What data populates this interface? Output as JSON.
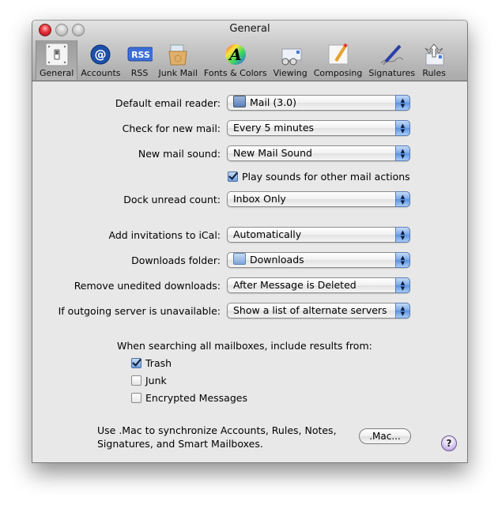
{
  "window": {
    "title": "General",
    "traffic_lights": [
      "close",
      "minimize",
      "zoom"
    ]
  },
  "toolbar": {
    "selected": "General",
    "items": [
      {
        "label": "General",
        "icon": "light-switch-icon"
      },
      {
        "label": "Accounts",
        "icon": "at-sign-icon"
      },
      {
        "label": "RSS",
        "icon": "rss-icon"
      },
      {
        "label": "Junk Mail",
        "icon": "junk-mail-icon"
      },
      {
        "label": "Fonts & Colors",
        "icon": "fonts-colors-icon"
      },
      {
        "label": "Viewing",
        "icon": "viewing-glasses-icon"
      },
      {
        "label": "Composing",
        "icon": "composing-pencil-icon"
      },
      {
        "label": "Signatures",
        "icon": "signature-pen-icon"
      },
      {
        "label": "Rules",
        "icon": "rules-arrows-icon"
      }
    ]
  },
  "settings": {
    "default_email_reader": {
      "label": "Default email reader:",
      "value": "Mail (3.0)",
      "icon": "mail-app-icon"
    },
    "check_new_mail": {
      "label": "Check for new mail:",
      "value": "Every 5 minutes"
    },
    "new_mail_sound": {
      "label": "New mail sound:",
      "value": "New Mail Sound"
    },
    "play_sounds": {
      "label": "Play sounds for other mail actions",
      "checked": true
    },
    "dock_unread_count": {
      "label": "Dock unread count:",
      "value": "Inbox Only"
    },
    "add_invitations": {
      "label": "Add invitations to iCal:",
      "value": "Automatically"
    },
    "downloads_folder": {
      "label": "Downloads folder:",
      "value": "Downloads",
      "icon": "downloads-folder-icon"
    },
    "remove_downloads": {
      "label": "Remove unedited downloads:",
      "value": "After Message is Deleted"
    },
    "outgoing_unavailable": {
      "label": "If outgoing server is unavailable:",
      "value": "Show a list of alternate servers"
    }
  },
  "search": {
    "heading": "When searching all mailboxes, include results from:",
    "options": [
      {
        "label": "Trash",
        "checked": true
      },
      {
        "label": "Junk",
        "checked": false
      },
      {
        "label": "Encrypted Messages",
        "checked": false
      }
    ]
  },
  "dotmac": {
    "line1": "Use .Mac to synchronize Accounts, Rules, Notes,",
    "line2": "Signatures, and Smart Mailboxes.",
    "button": ".Mac..."
  },
  "help": {
    "label": "?"
  },
  "colors": {
    "accent": "#5b92e0",
    "background": "#e8e8e8"
  }
}
